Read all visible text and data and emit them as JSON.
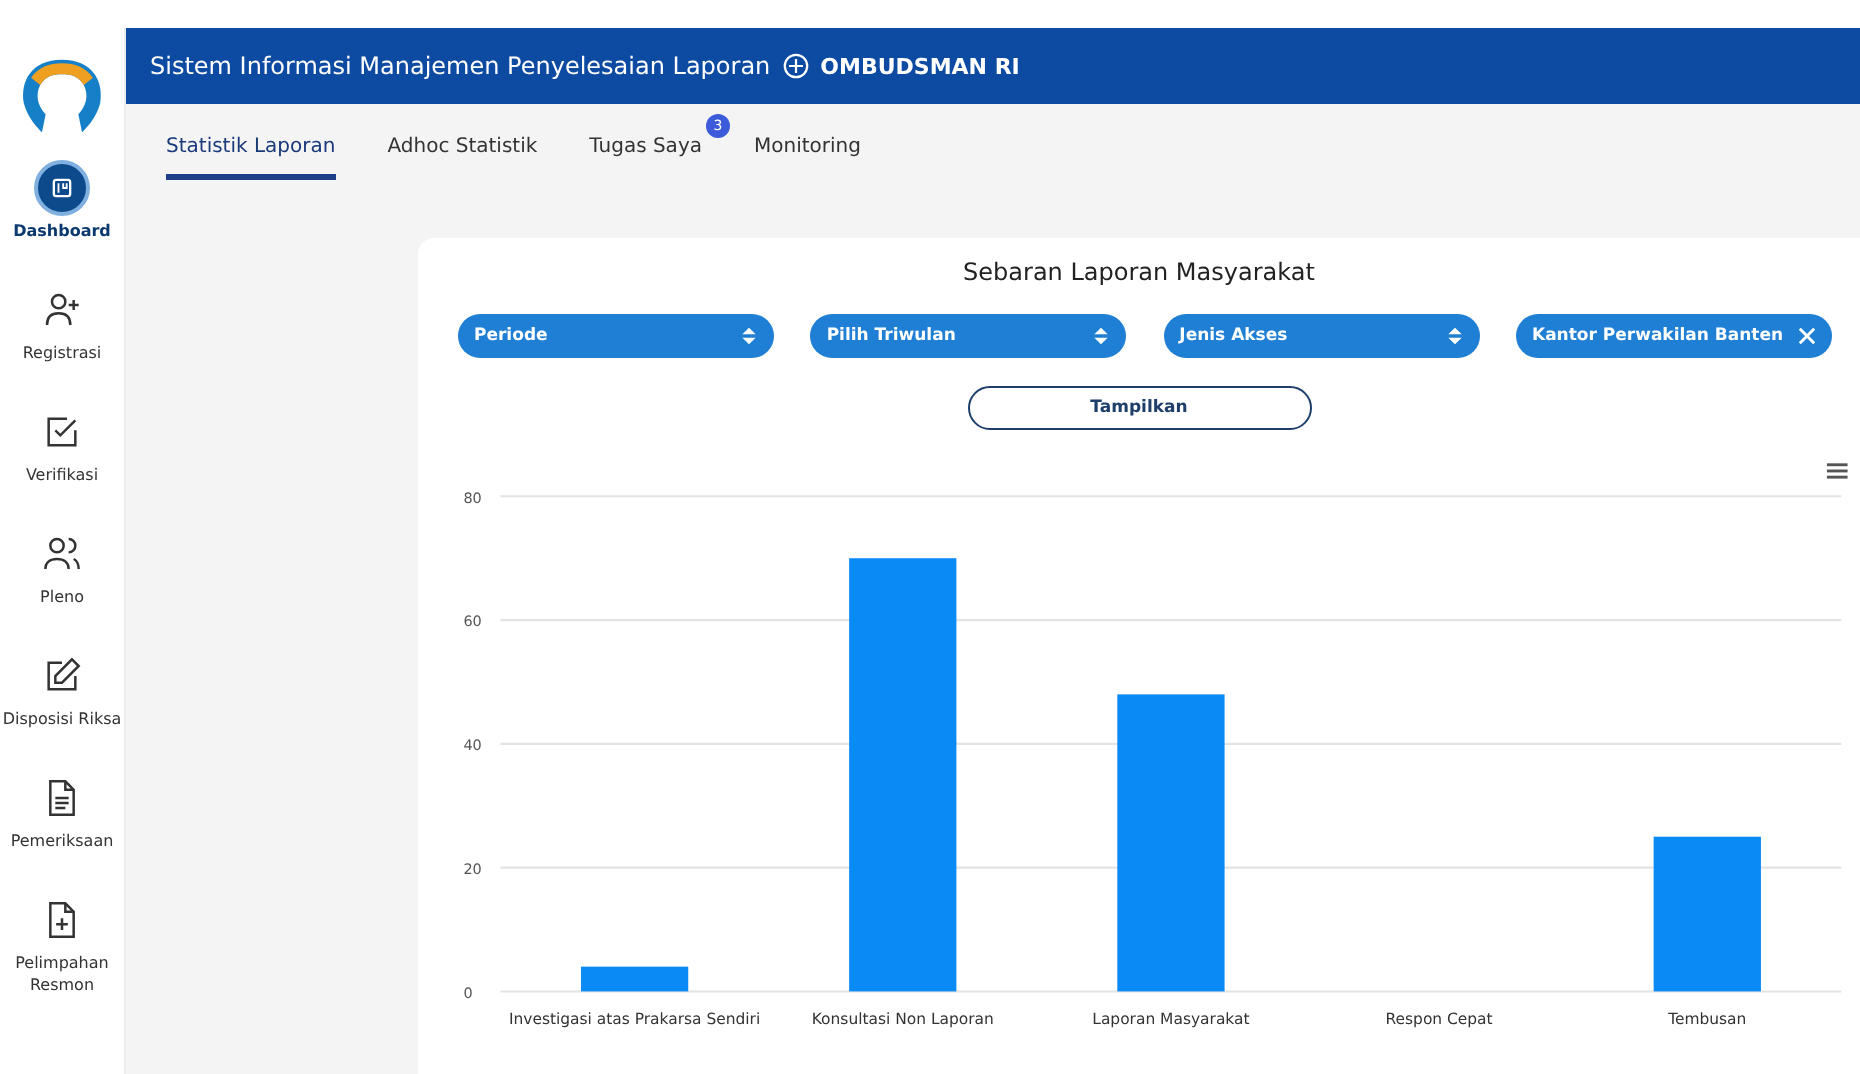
{
  "header": {
    "title": "Sistem Informasi Manajemen Penyelesaian Laporan",
    "org": "OMBUDSMAN RI"
  },
  "sidebar": {
    "items": [
      {
        "label": "Dashboard",
        "kind": "board",
        "selected": true
      },
      {
        "label": "Registrasi",
        "kind": "user-add",
        "selected": false
      },
      {
        "label": "Verifikasi",
        "kind": "check",
        "selected": false
      },
      {
        "label": "Pleno",
        "kind": "users",
        "selected": false
      },
      {
        "label": "Disposisi Riksa",
        "kind": "edit",
        "selected": false
      },
      {
        "label": "Pemeriksaan",
        "kind": "doc",
        "selected": false
      },
      {
        "label": "Pelimpahan Resmon",
        "kind": "doc-add",
        "selected": false
      }
    ]
  },
  "tabs": [
    {
      "label": "Statistik Laporan",
      "selected": true
    },
    {
      "label": "Adhoc Statistik",
      "selected": false
    },
    {
      "label": "Tugas Saya",
      "selected": false,
      "badge": "3"
    },
    {
      "label": "Monitoring",
      "selected": false
    }
  ],
  "card": {
    "title": "Sebaran Laporan Masyarakat",
    "filters": [
      {
        "label": "Periode",
        "kind": "select"
      },
      {
        "label": "Pilih Triwulan",
        "kind": "select"
      },
      {
        "label": "Jenis Akses",
        "kind": "select"
      },
      {
        "label": "Kantor Perwakilan Banten",
        "kind": "clear"
      }
    ],
    "button": "Tampilkan",
    "chart_data": {
      "type": "bar",
      "categories": [
        "Investigasi atas Prakarsa Sendiri",
        "Konsultasi Non Laporan",
        "Laporan Masyarakat",
        "Respon Cepat",
        "Tembusan"
      ],
      "values": [
        4,
        70,
        48,
        0,
        25
      ],
      "ylim": [
        0,
        80
      ],
      "yticks": [
        0,
        20,
        40,
        60,
        80
      ],
      "grid": true
    }
  }
}
